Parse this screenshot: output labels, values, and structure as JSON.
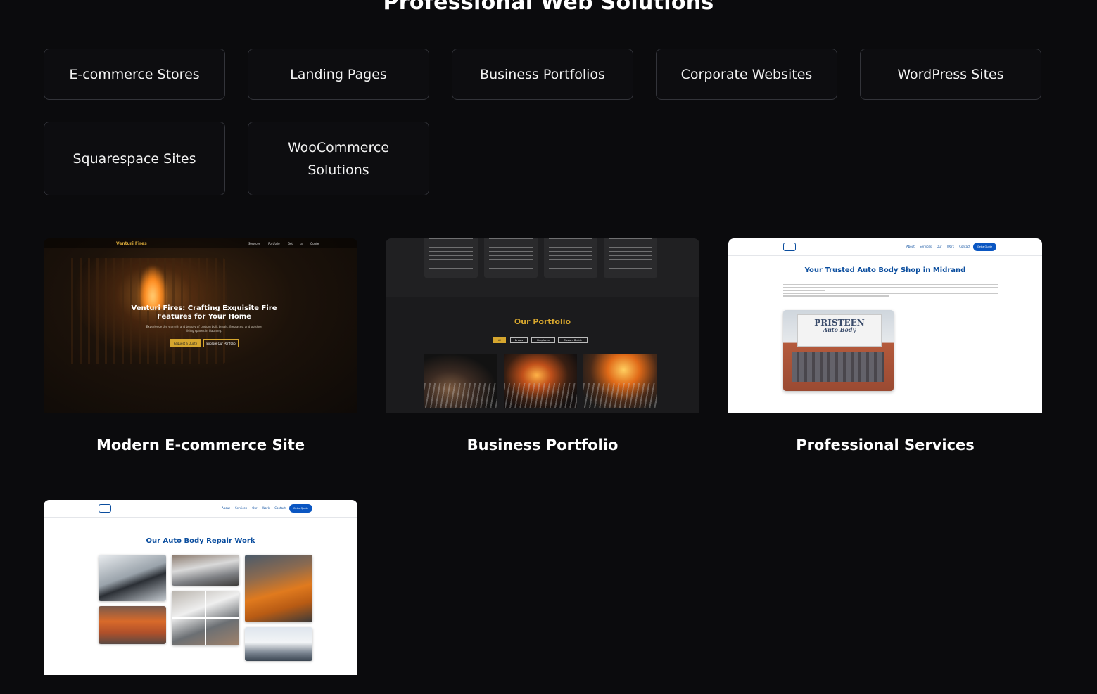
{
  "section": {
    "title": "Professional Web Solutions"
  },
  "services": [
    "E-commerce Stores",
    "Landing Pages",
    "Business Portfolios",
    "Corporate Websites",
    "WordPress Sites",
    "Squarespace Sites",
    "WooCommerce Solutions"
  ],
  "projects": [
    {
      "title": "Modern E-commerce Site",
      "preview": {
        "brand": "Venturi Fires",
        "nav_links": "Services Portfolio Get a Quote",
        "headline": "Venturi Fires: Crafting Exquisite Fire Features for Your Home",
        "subline": "Experience the warmth and beauty of custom built braais, fireplaces, and outdoor living spaces in Gauteng.",
        "primary_button": "Request a Quote",
        "secondary_button": "Explore Our Portfolio"
      }
    },
    {
      "title": "Business Portfolio",
      "preview": {
        "heading": "Our Portfolio",
        "filters": [
          "All",
          "Braais",
          "Fireplaces",
          "Custom Builds"
        ]
      }
    },
    {
      "title": "Professional Services",
      "preview": {
        "nav_links": "About Services Our Work Contact",
        "cta": "Get a Quote",
        "heading": "Your Trusted Auto Body Shop in Midrand",
        "sign_text": "PRISTEEN",
        "sign_sub": "Auto Body"
      }
    },
    {
      "title": "",
      "preview": {
        "nav_links": "About Services Our Work Contact",
        "cta": "Get a Quote",
        "heading": "Our Auto Body Repair Work"
      }
    }
  ],
  "colors": {
    "background": "#0b0b0d",
    "card_border": "#33343a",
    "gold_accent": "#d6a62e",
    "brand_blue": "#0a4d9e"
  }
}
